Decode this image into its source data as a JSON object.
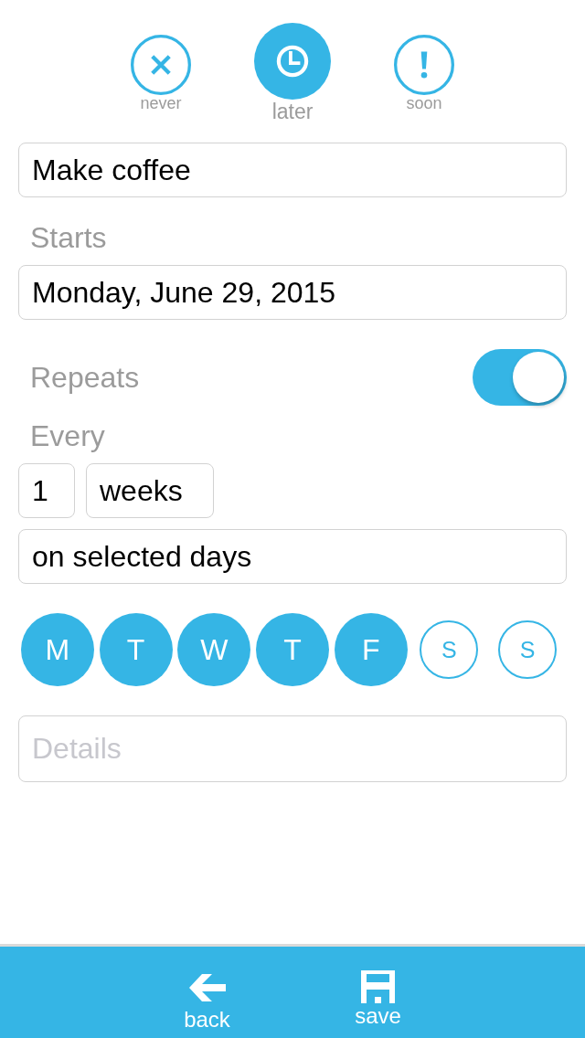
{
  "priority_options": [
    {
      "kind": "dismiss",
      "label": "never",
      "selected": false
    },
    {
      "kind": "postpone",
      "label": "later",
      "selected": true
    },
    {
      "kind": "urgent",
      "label": "soon",
      "selected": false
    }
  ],
  "title_field": {
    "value": "Make coffee"
  },
  "starts": {
    "label": "Starts",
    "value": "Monday, June 29, 2015"
  },
  "repeats": {
    "label": "Repeats",
    "on": true
  },
  "every": {
    "label": "Every",
    "count": "1",
    "unit": "weeks"
  },
  "pattern_field": {
    "value": "on selected days"
  },
  "days": [
    {
      "label": "M",
      "selected": true
    },
    {
      "label": "T",
      "selected": true
    },
    {
      "label": "W",
      "selected": true
    },
    {
      "label": "T",
      "selected": true
    },
    {
      "label": "F",
      "selected": true
    },
    {
      "label": "S",
      "selected": false
    },
    {
      "label": "S",
      "selected": false
    }
  ],
  "details_field": {
    "placeholder": "Details"
  },
  "bottom_bar": {
    "buttons": [
      {
        "kind": "back",
        "label": "back"
      },
      {
        "kind": "save",
        "label": "save"
      }
    ]
  }
}
